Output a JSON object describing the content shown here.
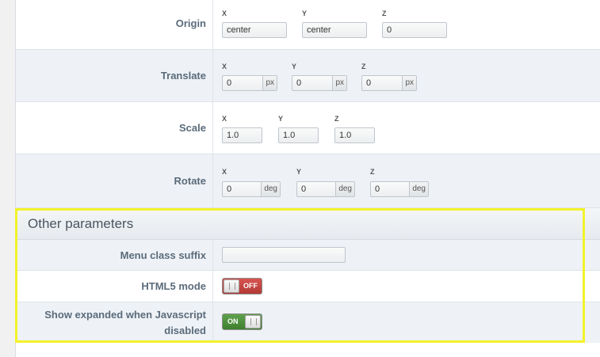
{
  "transform": {
    "origin": {
      "label": "Origin",
      "x_label": "X",
      "y_label": "Y",
      "z_label": "Z",
      "x": "center",
      "y": "center",
      "z": "0"
    },
    "translate": {
      "label": "Translate",
      "x_label": "X",
      "y_label": "Y",
      "z_label": "Z",
      "x": "0",
      "y": "0",
      "z": "0",
      "unit": "px"
    },
    "scale": {
      "label": "Scale",
      "x_label": "X",
      "y_label": "Y",
      "z_label": "Z",
      "x": "1.0",
      "y": "1.0",
      "z": "1.0"
    },
    "rotate": {
      "label": "Rotate",
      "x_label": "X",
      "y_label": "Y",
      "z_label": "Z",
      "x": "0",
      "y": "0",
      "z": "0",
      "unit": "deg"
    }
  },
  "other": {
    "title": "Other parameters",
    "menu_class_suffix": {
      "label": "Menu class suffix",
      "value": ""
    },
    "html5_mode": {
      "label": "HTML5 mode",
      "state": "OFF"
    },
    "show_expanded": {
      "label_line1": "Show expanded when Javascript",
      "label_line2": "disabled",
      "state": "ON"
    }
  },
  "colors": {
    "toggle_off": "#c9443f",
    "toggle_on": "#4f8f3e",
    "highlight": "#f2f22a"
  }
}
